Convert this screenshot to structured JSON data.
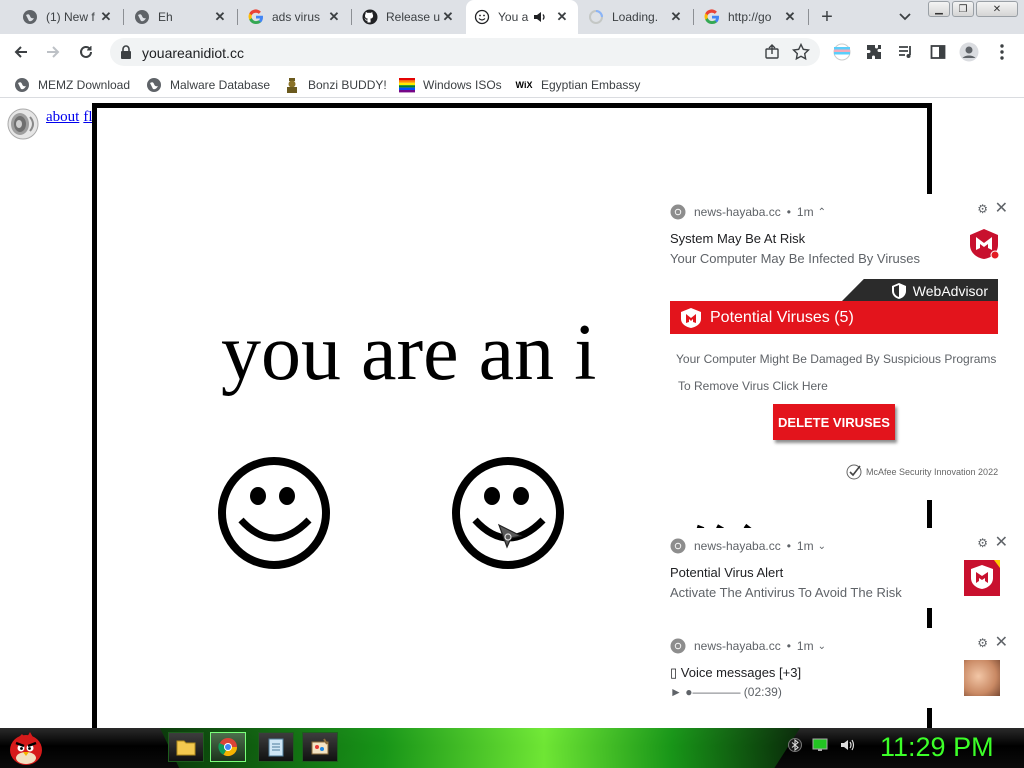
{
  "browser": {
    "tabs": [
      {
        "title": "(1) New f",
        "favicon": "globe-icon"
      },
      {
        "title": "Eh",
        "favicon": "globe-icon"
      },
      {
        "title": "ads virus",
        "favicon": "google-icon"
      },
      {
        "title": "Release u",
        "favicon": "github-icon"
      },
      {
        "title": "You a",
        "favicon": "smiley-icon",
        "active": true,
        "audio": true
      },
      {
        "title": "Loading.",
        "favicon": "spinner-icon"
      },
      {
        "title": "http://go",
        "favicon": "google-icon"
      }
    ],
    "url": "youareanidiot.cc",
    "bookmarks": [
      {
        "label": "MEMZ Download",
        "icon": "globe-icon"
      },
      {
        "label": "Malware Database",
        "icon": "globe-icon"
      },
      {
        "label": "Bonzi BUDDY!",
        "icon": "bonzi-icon"
      },
      {
        "label": "Windows ISOs",
        "icon": "windows-flag-icon"
      },
      {
        "label": "Egyptian Embassy",
        "icon": "wix-icon"
      }
    ]
  },
  "page": {
    "links": {
      "about": "about",
      "flash": "flash"
    },
    "big_text": "you are an i"
  },
  "notifications": [
    {
      "site": "news-hayaba.cc",
      "time": "1m",
      "chevron": "up",
      "title": "System May Be At Risk",
      "message": "Your Computer May Be Infected By Viruses",
      "webadvisor": {
        "brand": "WebAdvisor",
        "headline": "Potential Viruses (5)",
        "line1": "Your Computer Might Be Damaged By Suspicious Programs",
        "line2": "To Remove Virus Click Here",
        "button": "DELETE VIRUSES",
        "footer": "McAfee Security Innovation 2022"
      }
    },
    {
      "site": "news-hayaba.cc",
      "time": "1m",
      "chevron": "down",
      "title": "Potential Virus Alert",
      "message": "Activate The Antivirus To Avoid The Risk"
    },
    {
      "site": "news-hayaba.cc",
      "time": "1m",
      "chevron": "down",
      "title": "▯ Voice messages [+3]",
      "message": "► ●———— (02:39)"
    }
  ],
  "taskbar": {
    "clock": "11:29 PM",
    "accent": "#3cff28"
  }
}
